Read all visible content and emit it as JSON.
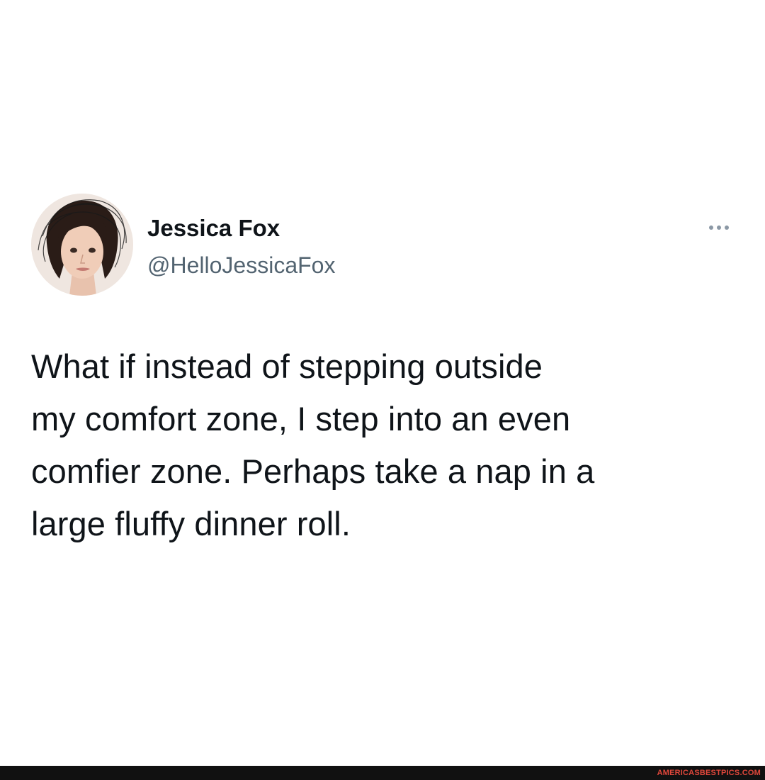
{
  "tweet": {
    "author": {
      "display_name": "Jessica Fox",
      "handle": "@HelloJessicaFox",
      "avatar_icon": "profile-photo"
    },
    "more_icon": "ellipsis-icon",
    "text_lines": [
      "What if instead of stepping outside",
      "my comfort zone, I step into an even",
      "comfier zone. Perhaps take a nap in a",
      "large fluffy dinner roll."
    ]
  },
  "watermark": {
    "text": "AMERICASBESTPICS.COM"
  },
  "colors": {
    "background": "#ffffff",
    "text_primary": "#0f1419",
    "text_secondary": "#536471",
    "footer_bar": "#111111",
    "watermark": "#e0473b"
  }
}
